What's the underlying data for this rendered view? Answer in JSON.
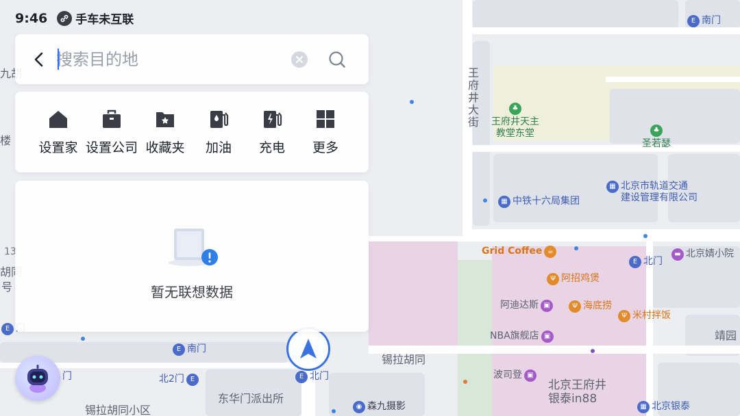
{
  "status": {
    "time": "9:46",
    "link_text": "手车未互联"
  },
  "search": {
    "placeholder": "搜索目的地",
    "value": ""
  },
  "quick_actions": [
    {
      "label": "设置家",
      "icon": "home-icon"
    },
    {
      "label": "设置公司",
      "icon": "briefcase-icon"
    },
    {
      "label": "收藏夹",
      "icon": "favorite-folder-icon"
    },
    {
      "label": "加油",
      "icon": "fuel-icon"
    },
    {
      "label": "充电",
      "icon": "charging-icon"
    },
    {
      "label": "更多",
      "icon": "grid-more-icon"
    }
  ],
  "suggestions": {
    "empty_text": "暂无联想数据"
  },
  "map": {
    "labels": {
      "wangfujing_street": "王府井大街",
      "xila_hutong": "锡拉胡同",
      "donghuamen": "东华门派出所",
      "xila_xiaoqu": "锡拉胡同小区",
      "jingyuan": "靖园",
      "num_13": "13",
      "hutong_edge": "胡同",
      "hao": "号",
      "jiu_hu": "九胡",
      "lou": "楼",
      "wangfujing_yintai": "北京王府井\n银泰in88"
    },
    "pois": [
      {
        "name": "南门",
        "type": "blue"
      },
      {
        "name": "王府井天主\n教堂东堂",
        "type": "green"
      },
      {
        "name": "圣若瑟",
        "type": "green"
      },
      {
        "name": "北京市轨道交通\n建设管理有限公司",
        "type": "blue"
      },
      {
        "name": "中铁十六局集团",
        "type": "blue"
      },
      {
        "name": "Grid Coffee",
        "type": "orange"
      },
      {
        "name": "北门",
        "type": "blue"
      },
      {
        "name": "北京婧小院",
        "type": "purple"
      },
      {
        "name": "阿招鸡煲",
        "type": "orange"
      },
      {
        "name": "阿迪达斯",
        "type": "purple"
      },
      {
        "name": "海底捞",
        "type": "orange"
      },
      {
        "name": "米村拌饭",
        "type": "orange"
      },
      {
        "name": "NBA旗舰店",
        "type": "purple"
      },
      {
        "name": "波司登",
        "type": "purple"
      },
      {
        "name": "南门",
        "type": "blue"
      },
      {
        "name": "北2门",
        "type": "blue"
      },
      {
        "name": "北门",
        "type": "blue"
      },
      {
        "name": "森九摄影",
        "type": "blue"
      },
      {
        "name": "北京银泰",
        "type": "blue"
      },
      {
        "name": "门",
        "type": "blue"
      },
      {
        "name": "门",
        "type": "blue"
      }
    ]
  },
  "colors": {
    "accent": "#2f6bff",
    "nav_ring": "#3a72e0"
  }
}
